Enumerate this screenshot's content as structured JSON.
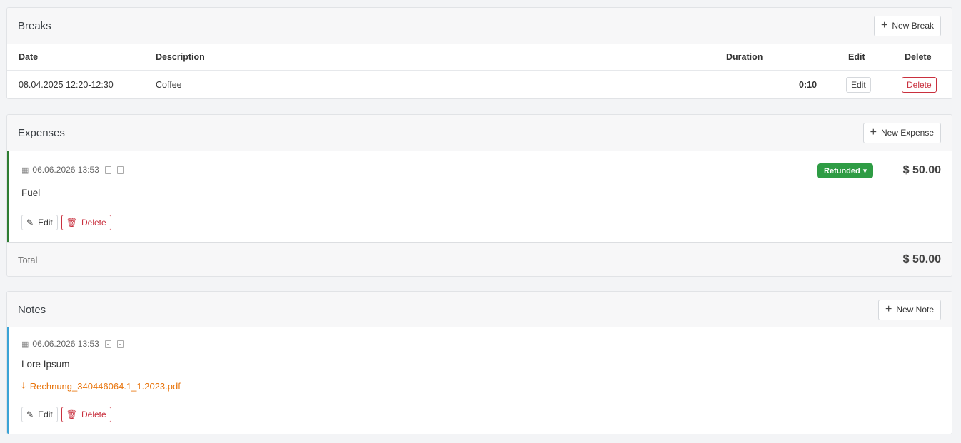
{
  "breaks": {
    "title": "Breaks",
    "new_button": "New Break",
    "columns": {
      "date": "Date",
      "description": "Description",
      "duration": "Duration",
      "edit": "Edit",
      "delete": "Delete"
    },
    "rows": [
      {
        "date": "08.04.2025 12:20-12:30",
        "description": "Coffee",
        "duration": "0:10",
        "edit": "Edit",
        "delete": "Delete"
      }
    ]
  },
  "expenses": {
    "title": "Expenses",
    "new_button": "New Expense",
    "items": [
      {
        "datetime": "06.06.2026 13:53",
        "status": "Refunded",
        "amount": "$ 50.00",
        "description": "Fuel",
        "edit": "Edit",
        "delete": "Delete"
      }
    ],
    "total_label": "Total",
    "total_amount": "$ 50.00"
  },
  "notes": {
    "title": "Notes",
    "new_button": "New Note",
    "items": [
      {
        "datetime": "06.06.2026 13:53",
        "text": "Lore Ipsum",
        "attachment": "Rechnung_340446064.1_1.2023.pdf",
        "edit": "Edit",
        "delete": "Delete"
      }
    ]
  },
  "colors": {
    "expense_accent": "#2e7d32",
    "note_accent": "#3aa3d6",
    "refunded_badge": "#2e9c44",
    "delete_red": "#c9303e",
    "link_orange": "#e8740c"
  },
  "icons": [
    "plus-icon",
    "calendar-icon",
    "pdf-file-icon",
    "file-icon",
    "pencil-icon",
    "trash-icon",
    "caret-down-icon",
    "download-icon"
  ]
}
